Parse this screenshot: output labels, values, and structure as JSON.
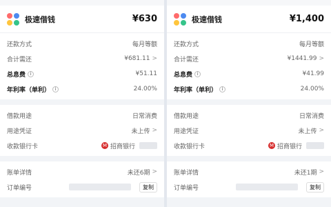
{
  "panels": [
    {
      "app_name": "极速借钱",
      "amount": "¥630",
      "repay_method_label": "还款方式",
      "repay_method_value": "每月等额",
      "total_repay_label": "合计需还",
      "total_repay_value": "¥681.11",
      "total_interest_label": "总息费",
      "total_interest_value": "¥51.11",
      "annual_rate_label": "年利率（单利）",
      "annual_rate_value": "24.00%",
      "purpose_label": "借款用途",
      "purpose_value": "日常消费",
      "voucher_label": "用途凭证",
      "voucher_value": "未上传",
      "bank_card_label": "收款银行卡",
      "bank_name": "招商银行",
      "bill_label": "账单详情",
      "bill_value": "未还6期",
      "order_label": "订单编号",
      "copy_label": "复制"
    },
    {
      "app_name": "极速借钱",
      "amount": "¥1,400",
      "repay_method_label": "还款方式",
      "repay_method_value": "每月等额",
      "total_repay_label": "合计需还",
      "total_repay_value": "¥1441.99",
      "total_interest_label": "总息费",
      "total_interest_value": "¥41.99",
      "annual_rate_label": "年利率（单利）",
      "annual_rate_value": "24.00%",
      "purpose_label": "借款用途",
      "purpose_value": "日常消费",
      "voucher_label": "用途凭证",
      "voucher_value": "未上传",
      "bank_card_label": "收款银行卡",
      "bank_name": "招商银行",
      "bill_label": "账单详情",
      "bill_value": "未还1期",
      "order_label": "订单编号",
      "copy_label": "复制"
    }
  ],
  "icons": {
    "info": "info-circle-icon",
    "chevron": "chevron-right-icon",
    "bank": "cmb-bank-icon",
    "app_logo": "app-logo-icon"
  },
  "colors": {
    "bank_red": "#d62b2b",
    "background": "#f2f4f7"
  }
}
